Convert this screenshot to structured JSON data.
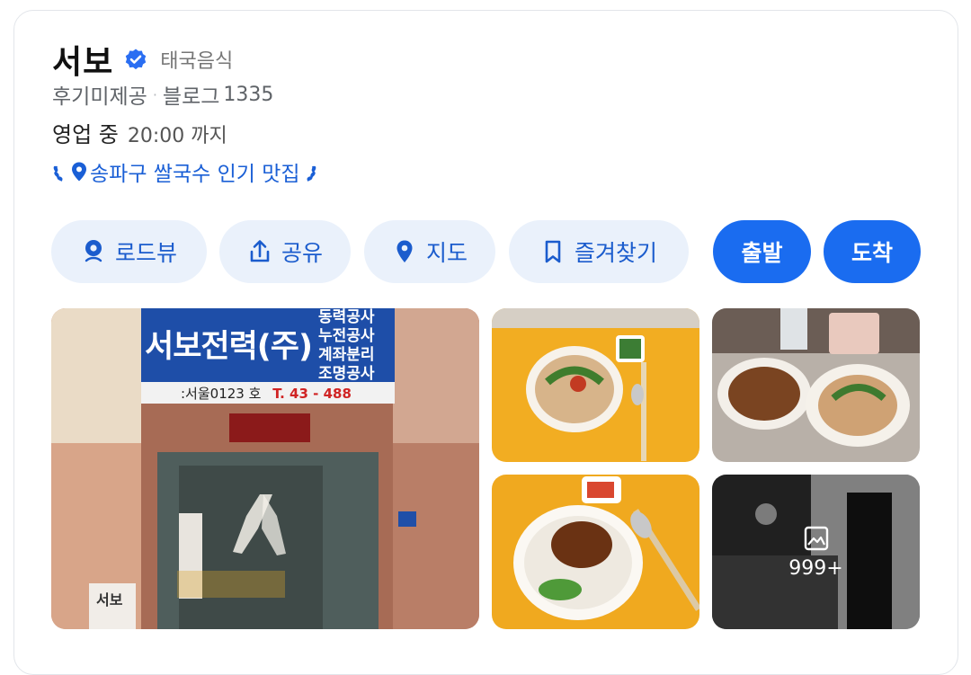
{
  "place": {
    "name": "서보",
    "category": "태국음식",
    "review_label": "후기미제공",
    "blog_label": "블로그",
    "blog_count": "1335",
    "status": "영업 중",
    "hours": "20:00 까지",
    "badge": "송파구 쌀국수 인기 맛집"
  },
  "actions": [
    {
      "label": "로드뷰",
      "icon": "roadview-icon"
    },
    {
      "label": "공유",
      "icon": "share-icon"
    },
    {
      "label": "지도",
      "icon": "map-pin-icon"
    },
    {
      "label": "즐겨찾기",
      "icon": "bookmark-icon"
    },
    {
      "label": "출발"
    },
    {
      "label": "도착"
    }
  ],
  "storefront_sign": {
    "main": "서보전력(주)",
    "services": [
      "동력공사",
      "누전공사",
      "계좌분리",
      "조명공사"
    ],
    "phone_line": ":서울0123 호",
    "phone": "T. 43 - 488",
    "small_sign": "서보"
  },
  "photos_more": "999+",
  "colors": {
    "accent": "#1a6cf0",
    "accent_text": "#1b5ccd",
    "action_bg": "#eaf1fb",
    "verified": "#2a6ef2"
  }
}
